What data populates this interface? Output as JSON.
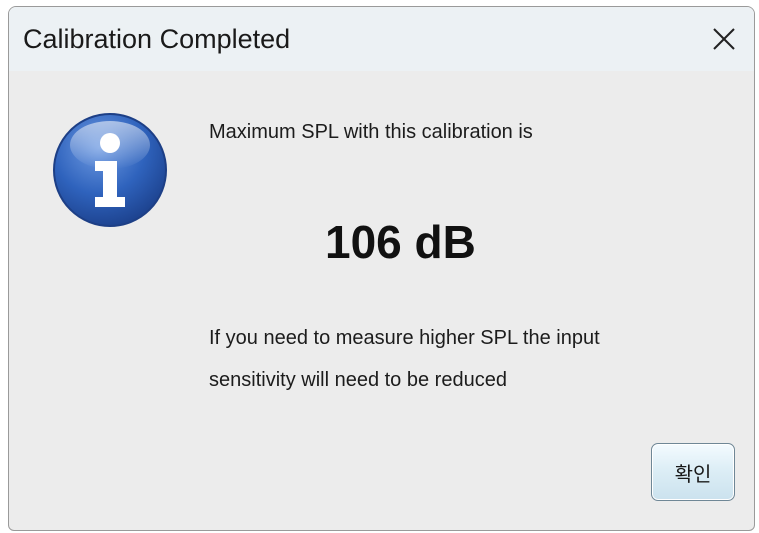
{
  "window": {
    "title": "Calibration Completed",
    "close_icon": "close-icon"
  },
  "message": {
    "icon": "info-icon",
    "line1": "Maximum SPL with this calibration is",
    "spl_value": "106 dB",
    "line2": "If you need to measure higher SPL the input",
    "line3": "sensitivity will need to be reduced"
  },
  "buttons": {
    "ok_label": "확인"
  },
  "colors": {
    "dialog_background": "#ececec",
    "titlebar_background": "#ecf1f4",
    "info_icon_blue": "#2a5fb8",
    "button_gradient_top": "#f4fbff",
    "button_gradient_bottom": "#cbe2ee"
  }
}
